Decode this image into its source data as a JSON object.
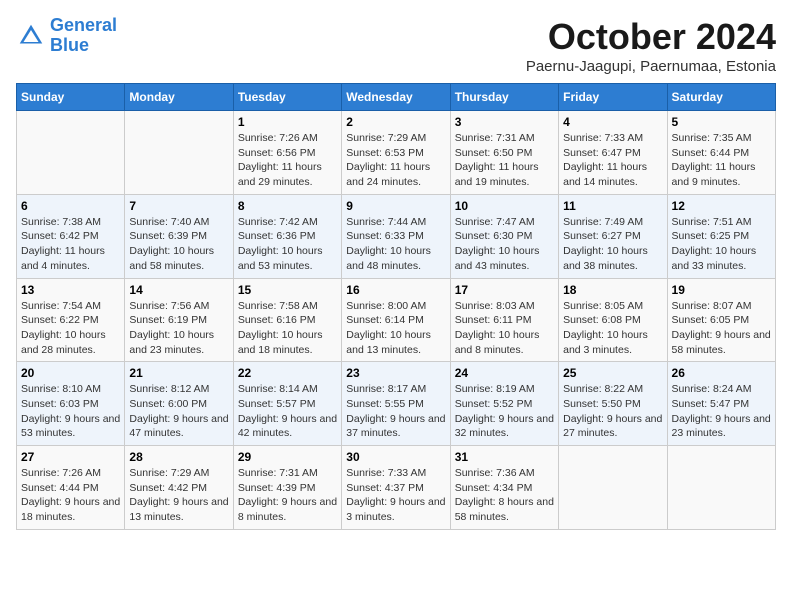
{
  "header": {
    "logo_line1": "General",
    "logo_line2": "Blue",
    "month": "October 2024",
    "location": "Paernu-Jaagupi, Paernumaa, Estonia"
  },
  "weekdays": [
    "Sunday",
    "Monday",
    "Tuesday",
    "Wednesday",
    "Thursday",
    "Friday",
    "Saturday"
  ],
  "weeks": [
    [
      {
        "day": "",
        "info": ""
      },
      {
        "day": "",
        "info": ""
      },
      {
        "day": "1",
        "info": "Sunrise: 7:26 AM\nSunset: 6:56 PM\nDaylight: 11 hours and 29 minutes."
      },
      {
        "day": "2",
        "info": "Sunrise: 7:29 AM\nSunset: 6:53 PM\nDaylight: 11 hours and 24 minutes."
      },
      {
        "day": "3",
        "info": "Sunrise: 7:31 AM\nSunset: 6:50 PM\nDaylight: 11 hours and 19 minutes."
      },
      {
        "day": "4",
        "info": "Sunrise: 7:33 AM\nSunset: 6:47 PM\nDaylight: 11 hours and 14 minutes."
      },
      {
        "day": "5",
        "info": "Sunrise: 7:35 AM\nSunset: 6:44 PM\nDaylight: 11 hours and 9 minutes."
      }
    ],
    [
      {
        "day": "6",
        "info": "Sunrise: 7:38 AM\nSunset: 6:42 PM\nDaylight: 11 hours and 4 minutes."
      },
      {
        "day": "7",
        "info": "Sunrise: 7:40 AM\nSunset: 6:39 PM\nDaylight: 10 hours and 58 minutes."
      },
      {
        "day": "8",
        "info": "Sunrise: 7:42 AM\nSunset: 6:36 PM\nDaylight: 10 hours and 53 minutes."
      },
      {
        "day": "9",
        "info": "Sunrise: 7:44 AM\nSunset: 6:33 PM\nDaylight: 10 hours and 48 minutes."
      },
      {
        "day": "10",
        "info": "Sunrise: 7:47 AM\nSunset: 6:30 PM\nDaylight: 10 hours and 43 minutes."
      },
      {
        "day": "11",
        "info": "Sunrise: 7:49 AM\nSunset: 6:27 PM\nDaylight: 10 hours and 38 minutes."
      },
      {
        "day": "12",
        "info": "Sunrise: 7:51 AM\nSunset: 6:25 PM\nDaylight: 10 hours and 33 minutes."
      }
    ],
    [
      {
        "day": "13",
        "info": "Sunrise: 7:54 AM\nSunset: 6:22 PM\nDaylight: 10 hours and 28 minutes."
      },
      {
        "day": "14",
        "info": "Sunrise: 7:56 AM\nSunset: 6:19 PM\nDaylight: 10 hours and 23 minutes."
      },
      {
        "day": "15",
        "info": "Sunrise: 7:58 AM\nSunset: 6:16 PM\nDaylight: 10 hours and 18 minutes."
      },
      {
        "day": "16",
        "info": "Sunrise: 8:00 AM\nSunset: 6:14 PM\nDaylight: 10 hours and 13 minutes."
      },
      {
        "day": "17",
        "info": "Sunrise: 8:03 AM\nSunset: 6:11 PM\nDaylight: 10 hours and 8 minutes."
      },
      {
        "day": "18",
        "info": "Sunrise: 8:05 AM\nSunset: 6:08 PM\nDaylight: 10 hours and 3 minutes."
      },
      {
        "day": "19",
        "info": "Sunrise: 8:07 AM\nSunset: 6:05 PM\nDaylight: 9 hours and 58 minutes."
      }
    ],
    [
      {
        "day": "20",
        "info": "Sunrise: 8:10 AM\nSunset: 6:03 PM\nDaylight: 9 hours and 53 minutes."
      },
      {
        "day": "21",
        "info": "Sunrise: 8:12 AM\nSunset: 6:00 PM\nDaylight: 9 hours and 47 minutes."
      },
      {
        "day": "22",
        "info": "Sunrise: 8:14 AM\nSunset: 5:57 PM\nDaylight: 9 hours and 42 minutes."
      },
      {
        "day": "23",
        "info": "Sunrise: 8:17 AM\nSunset: 5:55 PM\nDaylight: 9 hours and 37 minutes."
      },
      {
        "day": "24",
        "info": "Sunrise: 8:19 AM\nSunset: 5:52 PM\nDaylight: 9 hours and 32 minutes."
      },
      {
        "day": "25",
        "info": "Sunrise: 8:22 AM\nSunset: 5:50 PM\nDaylight: 9 hours and 27 minutes."
      },
      {
        "day": "26",
        "info": "Sunrise: 8:24 AM\nSunset: 5:47 PM\nDaylight: 9 hours and 23 minutes."
      }
    ],
    [
      {
        "day": "27",
        "info": "Sunrise: 7:26 AM\nSunset: 4:44 PM\nDaylight: 9 hours and 18 minutes."
      },
      {
        "day": "28",
        "info": "Sunrise: 7:29 AM\nSunset: 4:42 PM\nDaylight: 9 hours and 13 minutes."
      },
      {
        "day": "29",
        "info": "Sunrise: 7:31 AM\nSunset: 4:39 PM\nDaylight: 9 hours and 8 minutes."
      },
      {
        "day": "30",
        "info": "Sunrise: 7:33 AM\nSunset: 4:37 PM\nDaylight: 9 hours and 3 minutes."
      },
      {
        "day": "31",
        "info": "Sunrise: 7:36 AM\nSunset: 4:34 PM\nDaylight: 8 hours and 58 minutes."
      },
      {
        "day": "",
        "info": ""
      },
      {
        "day": "",
        "info": ""
      }
    ]
  ]
}
